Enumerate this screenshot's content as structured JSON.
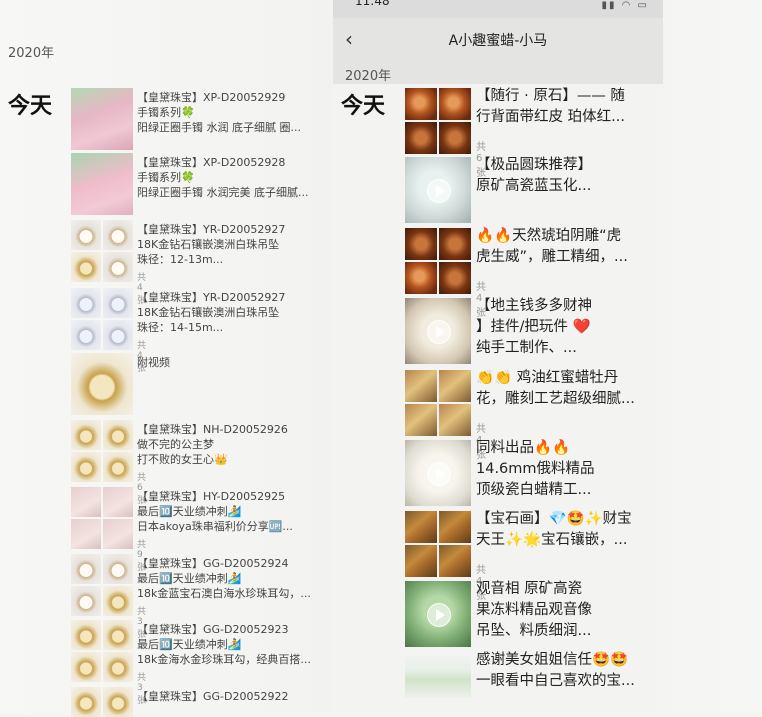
{
  "left": {
    "year": "2020年",
    "day": "今天",
    "posts": [
      {
        "lines": [
          "【皇黛珠宝】XP-D20052929",
          "手镯系列🍀",
          "阳绿正圈手镯 水润 底子细腻 圈..."
        ],
        "count": ""
      },
      {
        "lines": [
          "【皇黛珠宝】XP-D20052928",
          "手镯系列🍀",
          "阳绿正圈手镯 水润完美 底子细腻..."
        ],
        "count": ""
      },
      {
        "lines": [
          "【皇黛珠宝】YR-D20052927",
          "18K金钻石镶嵌澳洲白珠吊坠",
          "珠径：12-13m..."
        ],
        "count": "共4张"
      },
      {
        "lines": [
          "【皇黛珠宝】YR-D20052927",
          "18K金钻石镶嵌澳洲白珠吊坠",
          "珠径：14-15m..."
        ],
        "count": "共4张"
      },
      {
        "lines": [
          "附视频"
        ],
        "count": ""
      },
      {
        "lines": [
          "【皇黛珠宝】NH-D20052926",
          "做不完的公主梦",
          "打不败的女王心👑"
        ],
        "count": "共6张"
      },
      {
        "lines": [
          "【皇黛珠宝】HY-D20052925",
          "最后🔟天业绩冲刺🏄",
          "日本akoya珠串福利价分享🆙..."
        ],
        "count": "共9张"
      },
      {
        "lines": [
          "【皇黛珠宝】GG-D20052924",
          "最后🔟天业绩冲刺🏄",
          "18k金蓝宝石澳白海水珍珠耳勾，..."
        ],
        "count": "共3张"
      },
      {
        "lines": [
          "【皇黛珠宝】GG-D20052923",
          "最后🔟天业绩冲刺🏄",
          "18k金海水金珍珠耳勾，经典百搭..."
        ],
        "count": "共3张"
      },
      {
        "lines": [
          "【皇黛珠宝】GG-D20052922"
        ],
        "count": ""
      }
    ]
  },
  "right": {
    "status": {
      "time": "11:48",
      "icons": "▮▮ ◠ ▭"
    },
    "nav": {
      "back": "‹",
      "title": "A小趣蜜蜡-小马"
    },
    "year": "2020年",
    "day": "今天",
    "posts": [
      {
        "lines": [
          "【随行 · 原石】—— 随",
          "行背面带红皮 珀体红..."
        ],
        "count": "共6张"
      },
      {
        "lines": [
          "【极品圆珠推荐】",
          "",
          "原矿高瓷蓝玉化..."
        ],
        "count": ""
      },
      {
        "lines": [
          "🔥🔥天然琥珀阴雕“虎",
          "虎生威”，雕工精细，..."
        ],
        "count": "共4张"
      },
      {
        "lines": [
          "【地主钱多多财神",
          "】挂件/把玩件 ❤️",
          " 纯手工制作、..."
        ],
        "count": ""
      },
      {
        "lines": [
          "👏👏 鸡油红蜜蜡牡丹",
          "花，雕刻工艺超级细腻..."
        ],
        "count": "共4张"
      },
      {
        "lines": [
          "同料出品🔥🔥",
          "14.6mm俄料精品",
          "顶级瓷白蜡精工..."
        ],
        "count": ""
      },
      {
        "lines": [
          "【宝石画】💎🤩✨财宝",
          "天王✨🌟宝石镶嵌，..."
        ],
        "count": "共4张"
      },
      {
        "lines": [
          "观音相 原矿高瓷",
          "果冻料精品观音像",
          "吊坠、料质细润..."
        ],
        "count": ""
      },
      {
        "lines": [
          "感谢美女姐姐信任🤩🤩",
          "一眼看中自己喜欢的宝..."
        ],
        "count": ""
      }
    ]
  }
}
